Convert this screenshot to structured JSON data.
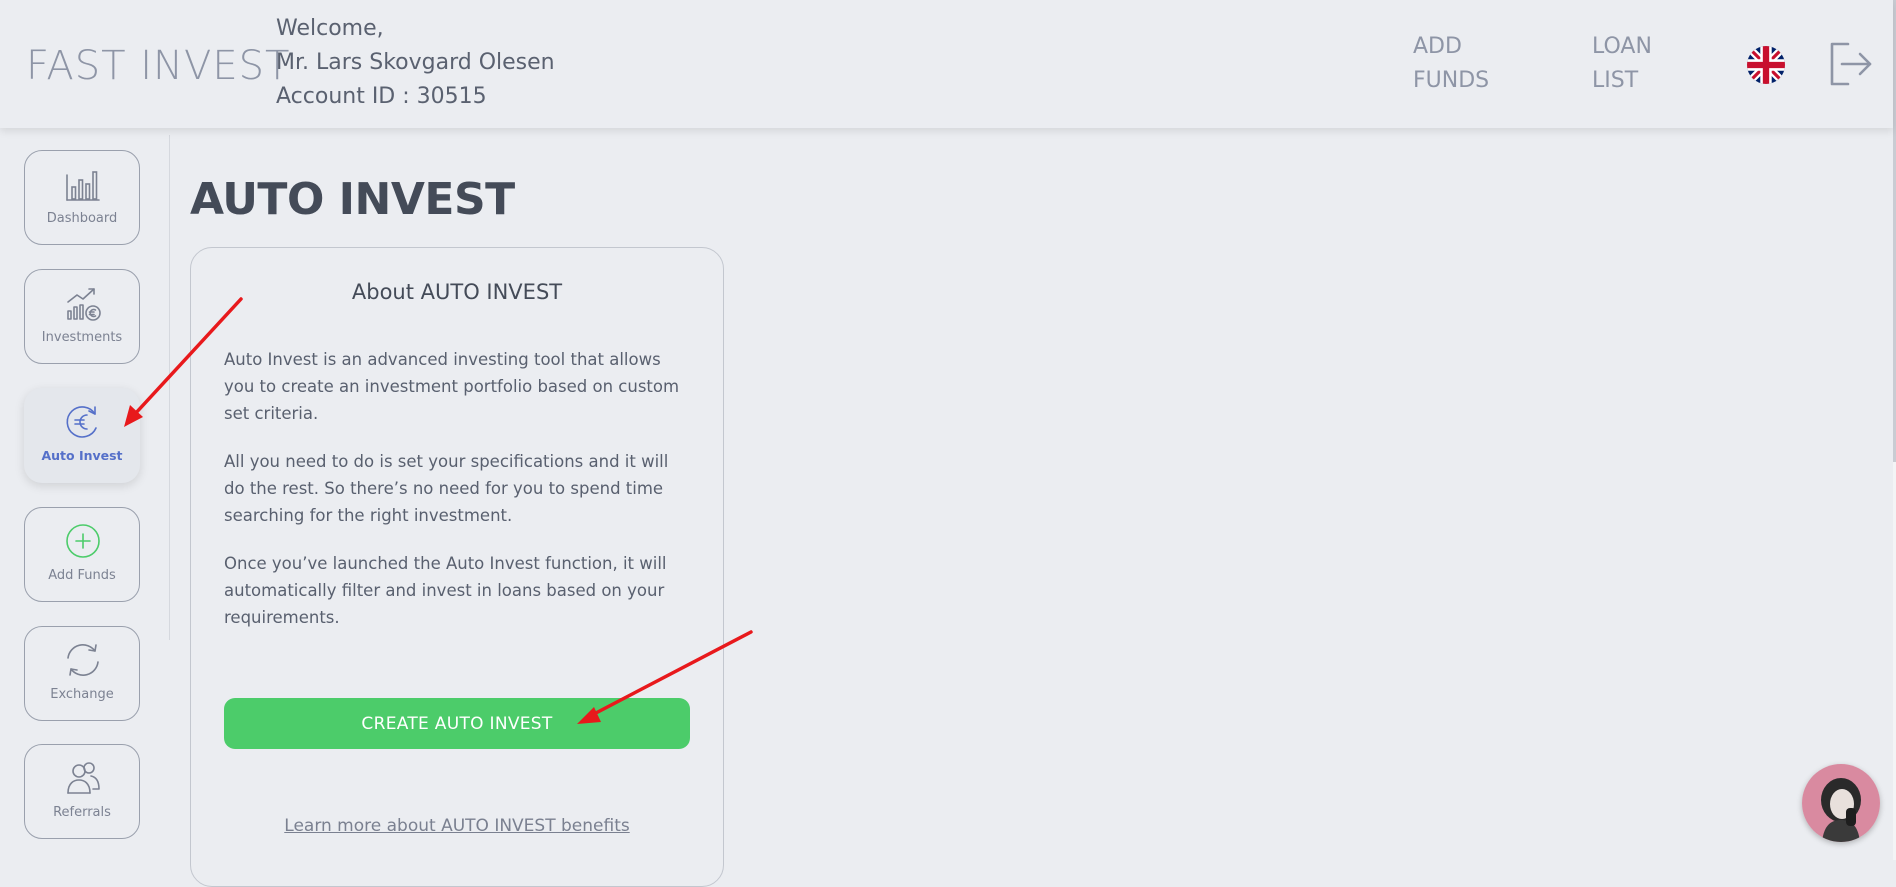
{
  "header": {
    "logo": "FAST INVEST",
    "welcome_line1": "Welcome,",
    "welcome_line2": "Mr. Lars Skovgard Olesen",
    "welcome_line3": "Account ID : 30515",
    "nav": [
      {
        "line1": "ADD",
        "line2": "FUNDS"
      },
      {
        "line1": "LOAN",
        "line2": "LIST"
      }
    ]
  },
  "sidebar": {
    "items": [
      {
        "label": "Dashboard",
        "icon": "bar-chart-icon"
      },
      {
        "label": "Investments",
        "icon": "growth-chart-euro-icon"
      },
      {
        "label": "Auto Invest",
        "icon": "euro-refresh-icon",
        "active": true
      },
      {
        "label": "Add Funds",
        "icon": "plus-circle-icon"
      },
      {
        "label": "Exchange",
        "icon": "exchange-arrows-icon"
      },
      {
        "label": "Referrals",
        "icon": "users-icon"
      }
    ]
  },
  "main": {
    "title": "AUTO INVEST",
    "card": {
      "title": "About AUTO INVEST",
      "paragraphs": [
        "Auto Invest is an advanced investing tool that allows you to create an investment portfolio based on custom set criteria.",
        "All you need to do is set your specifications and it will do the rest. So there’s no need for you to spend time searching for the right investment.",
        "Once you’ve launched the Auto Invest function, it will automatically filter and invest in loans based on your requirements."
      ],
      "cta_label": "CREATE AUTO INVEST",
      "learn_more": "Learn more about AUTO INVEST benefits"
    }
  },
  "colors": {
    "background": "#ebedf1",
    "accent_green": "#4ccc6a",
    "active_blue": "#5570c9",
    "annotation_red": "#e8191c"
  }
}
